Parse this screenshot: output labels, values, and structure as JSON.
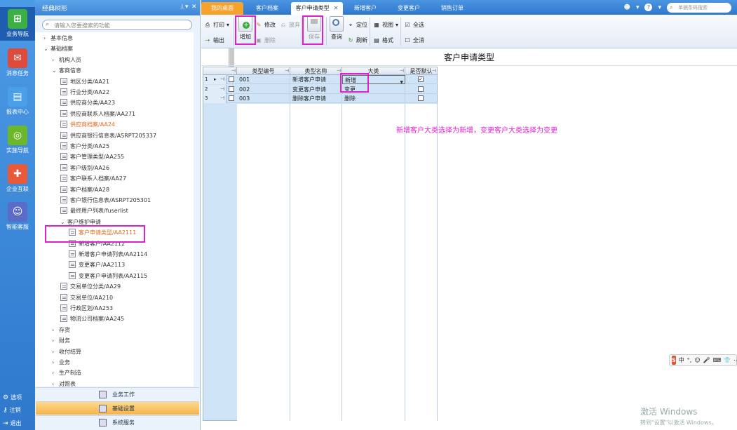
{
  "rail": {
    "items": [
      {
        "label": "业务导航",
        "icon": "grid-nav-icon",
        "glyph": "⊞",
        "color": "#3cb043"
      },
      {
        "label": "消息任务",
        "icon": "mail-icon",
        "glyph": "✉",
        "color": "#e04a3a"
      },
      {
        "label": "报表中心",
        "icon": "report-icon",
        "glyph": "▤",
        "color": "#4aa0e8"
      },
      {
        "label": "实施导航",
        "icon": "compass-icon",
        "glyph": "◎",
        "color": "#6cb82a"
      },
      {
        "label": "企业互联",
        "icon": "network-icon",
        "glyph": "✚",
        "color": "#e85a3a"
      },
      {
        "label": "智能客服",
        "icon": "robot-icon",
        "glyph": "☺",
        "color": "#5a6cc8"
      }
    ],
    "bottom": [
      {
        "label": "选项",
        "icon": "gear-icon",
        "glyph": "⚙"
      },
      {
        "label": "注销",
        "icon": "key-icon",
        "glyph": "⚷"
      },
      {
        "label": "退出",
        "icon": "exit-icon",
        "glyph": "⇥"
      }
    ]
  },
  "tree_panel": {
    "title": "经典树形",
    "pin_glyph": "⊥",
    "dropdown_glyph": "▾",
    "close_glyph": "✕",
    "search_placeholder": "请输入您要搜索的功能",
    "nodes": [
      {
        "label": "基本信息",
        "level": 0,
        "toggle": "›",
        "type": "folder"
      },
      {
        "label": "基础档案",
        "level": 0,
        "toggle": "⌄",
        "type": "folder"
      },
      {
        "label": "机构人员",
        "level": 1,
        "toggle": "›",
        "type": "folder"
      },
      {
        "label": "客商信息",
        "level": 1,
        "toggle": "⌄",
        "type": "folder"
      },
      {
        "label": "地区分类/AA21",
        "level": 2,
        "type": "doc"
      },
      {
        "label": "行业分类/AA22",
        "level": 2,
        "type": "doc"
      },
      {
        "label": "供应商分类/AA23",
        "level": 2,
        "type": "doc"
      },
      {
        "label": "供应商联系人档案/AA271",
        "level": 2,
        "type": "doc"
      },
      {
        "label": "供应商档案/AA24",
        "level": 2,
        "type": "doc",
        "orange": true
      },
      {
        "label": "供应商银行信息表/ASRPT205337",
        "level": 2,
        "type": "doc"
      },
      {
        "label": "客户分类/AA25",
        "level": 2,
        "type": "doc"
      },
      {
        "label": "客户管理类型/AA255",
        "level": 2,
        "type": "doc"
      },
      {
        "label": "客户级别/AA26",
        "level": 2,
        "type": "doc"
      },
      {
        "label": "客户联系人档案/AA27",
        "level": 2,
        "type": "doc"
      },
      {
        "label": "客户档案/AA28",
        "level": 2,
        "type": "doc"
      },
      {
        "label": "客户银行信息表/ASRPT205301",
        "level": 2,
        "type": "doc"
      },
      {
        "label": "最终用户列表/fuserlist",
        "level": 2,
        "type": "doc"
      },
      {
        "label": "客户维护申请",
        "level": 2,
        "toggle": "⌄",
        "type": "folder"
      },
      {
        "label": "客户申请类型/AA2111",
        "level": 3,
        "type": "doc",
        "orange": true
      },
      {
        "label": "新增客户/AA2112",
        "level": 3,
        "type": "doc"
      },
      {
        "label": "新增客户申请列表/AA2114",
        "level": 3,
        "type": "doc"
      },
      {
        "label": "变更客户/AA2113",
        "level": 3,
        "type": "doc"
      },
      {
        "label": "变更客户申请列表/AA2115",
        "level": 3,
        "type": "doc"
      },
      {
        "label": "交易单位分类/AA29",
        "level": 2,
        "type": "doc"
      },
      {
        "label": "交易单位/AA210",
        "level": 2,
        "type": "doc"
      },
      {
        "label": "行政区划/AA253",
        "level": 2,
        "type": "doc"
      },
      {
        "label": "物流公司档案/AA245",
        "level": 2,
        "type": "doc"
      },
      {
        "label": "存货",
        "level": 1,
        "toggle": "›",
        "type": "folder"
      },
      {
        "label": "财务",
        "level": 1,
        "toggle": "›",
        "type": "folder"
      },
      {
        "label": "收付结算",
        "level": 1,
        "toggle": "›",
        "type": "folder"
      },
      {
        "label": "业务",
        "level": 1,
        "toggle": "›",
        "type": "folder"
      },
      {
        "label": "生产制造",
        "level": 1,
        "toggle": "›",
        "type": "folder"
      },
      {
        "label": "对照表",
        "level": 1,
        "toggle": "›",
        "type": "folder"
      }
    ],
    "bottom_tabs": [
      {
        "label": "业务工作",
        "icon": "briefcase-icon"
      },
      {
        "label": "基础设置",
        "icon": "settings-icon",
        "active": true
      },
      {
        "label": "系统服务",
        "icon": "service-icon"
      }
    ]
  },
  "tabs": [
    {
      "label": "我的桌面",
      "kind": "home"
    },
    {
      "label": "客户档案"
    },
    {
      "label": "客户申请类型",
      "kind": "active",
      "close_glyph": "✕"
    },
    {
      "label": "新增客户"
    },
    {
      "label": "变更客户"
    },
    {
      "label": "销售订单"
    }
  ],
  "topbar": {
    "user_glyph": "☻",
    "caret_glyph": "▾",
    "help_glyph": "?",
    "search_placeholder": "单据条码搜索"
  },
  "toolbar": {
    "print": "打印",
    "export": "输出",
    "add": "增加",
    "edit": "修改",
    "delete": "删除",
    "abandon": "放弃",
    "save": "保存",
    "query": "查询",
    "locate": "定位",
    "refresh": "刷新",
    "view": "视图",
    "format": "格式",
    "select_all": "全选",
    "deselect_all": "全消"
  },
  "page_title": "客户申请类型",
  "grid": {
    "columns": [
      "类型编号",
      "类型名称",
      "大类",
      "是否默认"
    ],
    "rows": [
      {
        "num": "1",
        "code": "001",
        "name": "新增客户申请",
        "category": "新增",
        "default": true
      },
      {
        "num": "2",
        "code": "002",
        "name": "变更客户申请",
        "category": "变更",
        "default": false
      },
      {
        "num": "3",
        "code": "003",
        "name": "删除客户申请",
        "category": "删除",
        "default": false
      }
    ]
  },
  "annotation": "新增客户大类选择为新增，变更客户大类选择为变更",
  "ime": {
    "logo": "S",
    "items": [
      "中",
      "°,",
      "☺",
      "🎤",
      "⌨",
      "👕",
      "⋯"
    ]
  },
  "watermark": {
    "line1": "激活 Windows",
    "line2": "转到\"设置\"以激活 Windows。"
  }
}
